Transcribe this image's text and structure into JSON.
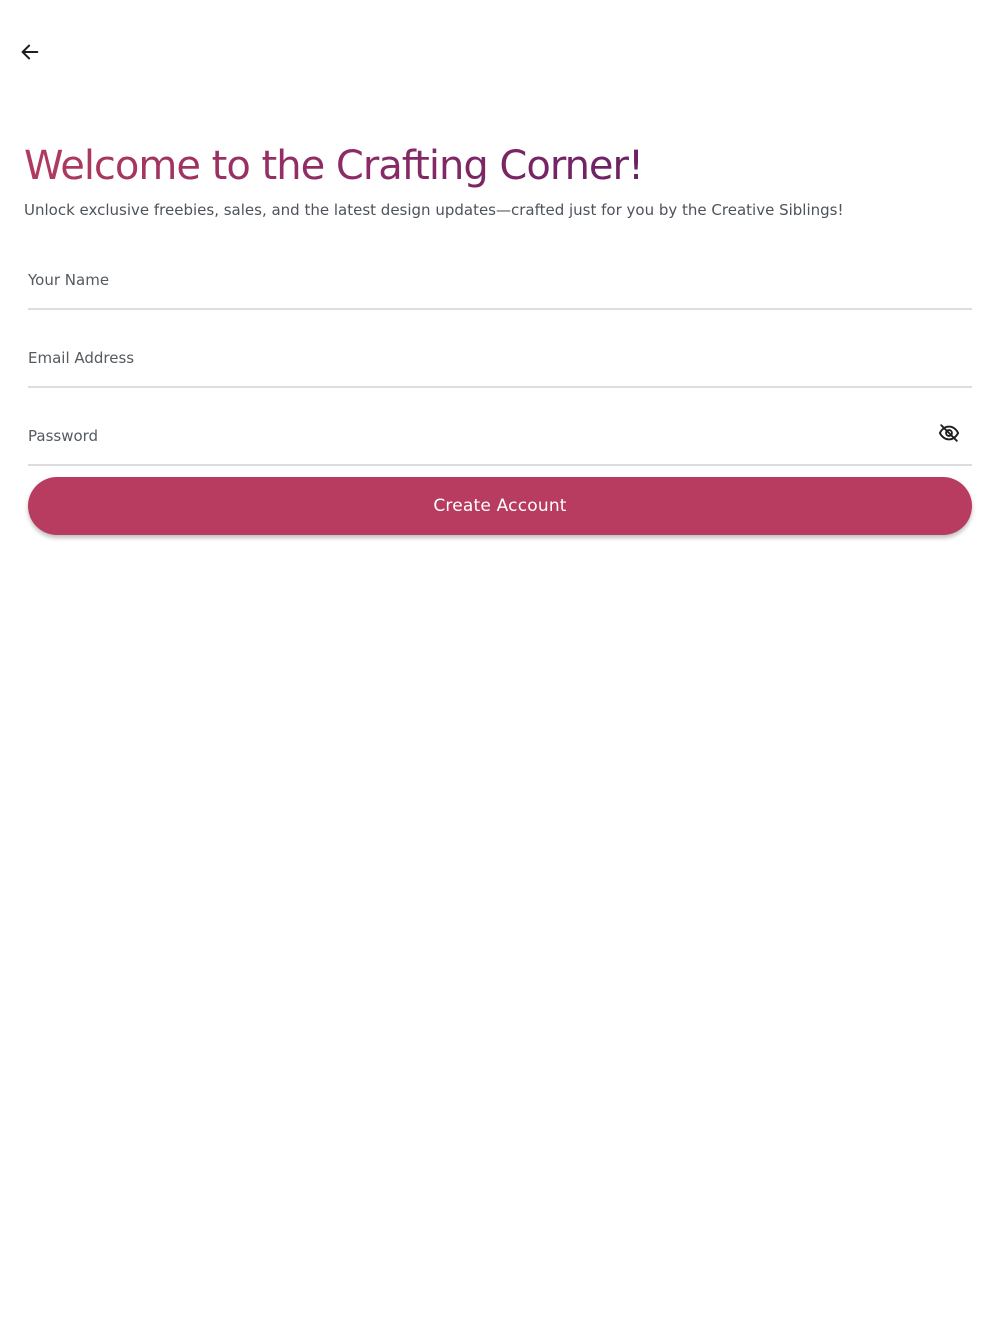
{
  "header": {
    "back_icon": "arrow-left-icon"
  },
  "hero": {
    "title": "Welcome to the Crafting Corner!",
    "subtitle": "Unlock exclusive freebies, sales, and the latest design updates—crafted just for you by the Creative Siblings!"
  },
  "form": {
    "name_label": "Your Name",
    "email_label": "Email Address",
    "password_label": "Password",
    "password_visibility_icon": "eye-off-icon",
    "submit_label": "Create Account"
  },
  "colors": {
    "title_gradient_start": "#b13b5e",
    "title_gradient_end": "#6b2163",
    "button": "#b83b60",
    "underline": "#dcdde0"
  }
}
